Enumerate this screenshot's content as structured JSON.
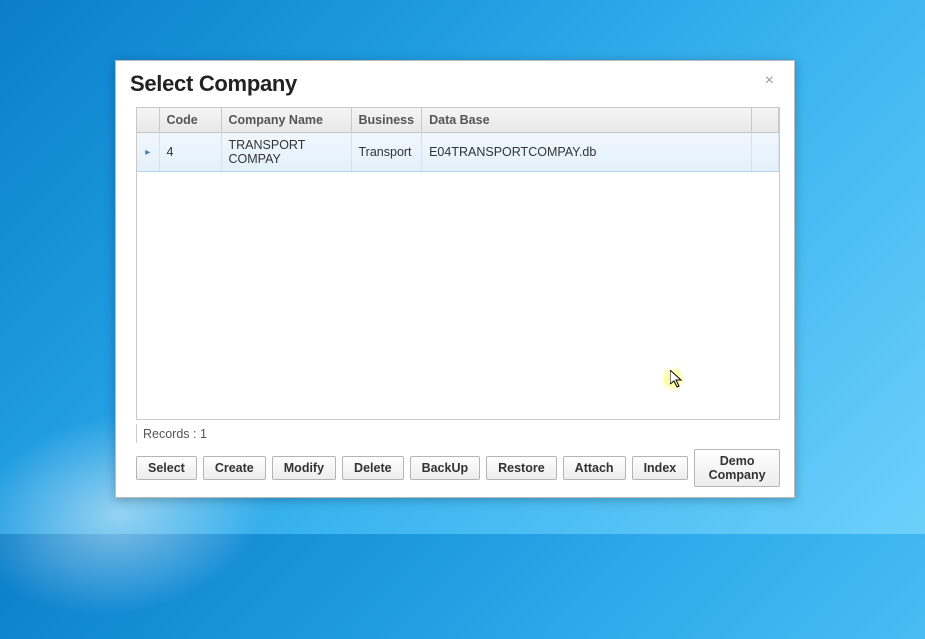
{
  "dialog": {
    "title": "Select Company",
    "close_label": "×"
  },
  "grid": {
    "columns": {
      "code": "Code",
      "company_name": "Company Name",
      "business": "Business",
      "database": "Data Base"
    },
    "rows": [
      {
        "indicator": "▸",
        "code": "4",
        "company_name": "TRANSPORT COMPAY",
        "business": "Transport",
        "database": "E04TRANSPORTCOMPAY.db"
      }
    ]
  },
  "status": {
    "records_label": "Records : 1"
  },
  "buttons": {
    "select": "Select",
    "create": "Create",
    "modify": "Modify",
    "delete": "Delete",
    "backup": "BackUp",
    "restore": "Restore",
    "attach": "Attach",
    "index": "Index",
    "demo": "Demo Company"
  }
}
